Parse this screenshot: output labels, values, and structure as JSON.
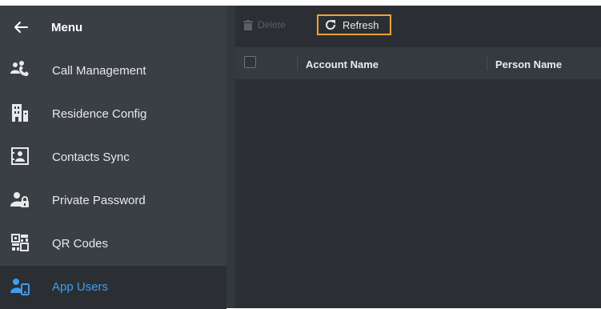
{
  "menu": {
    "title": "Menu"
  },
  "sidebar": {
    "items": [
      {
        "label": "Call Management",
        "icon": "call-management-icon"
      },
      {
        "label": "Residence Config",
        "icon": "residence-config-icon"
      },
      {
        "label": "Contacts Sync",
        "icon": "contacts-sync-icon"
      },
      {
        "label": "Private Password",
        "icon": "private-password-icon"
      },
      {
        "label": "QR Codes",
        "icon": "qr-code-icon"
      },
      {
        "label": "App Users",
        "icon": "app-users-icon",
        "active": true
      }
    ]
  },
  "toolbar": {
    "delete_label": "Delete",
    "refresh_label": "Refresh"
  },
  "table": {
    "columns": [
      "Account Name",
      "Person Name"
    ],
    "rows": []
  },
  "colors": {
    "sidebar_bg": "#3a3f45",
    "main_bg": "#2b2f34",
    "accent": "#3d9df3",
    "highlight_border": "#f5a235"
  }
}
